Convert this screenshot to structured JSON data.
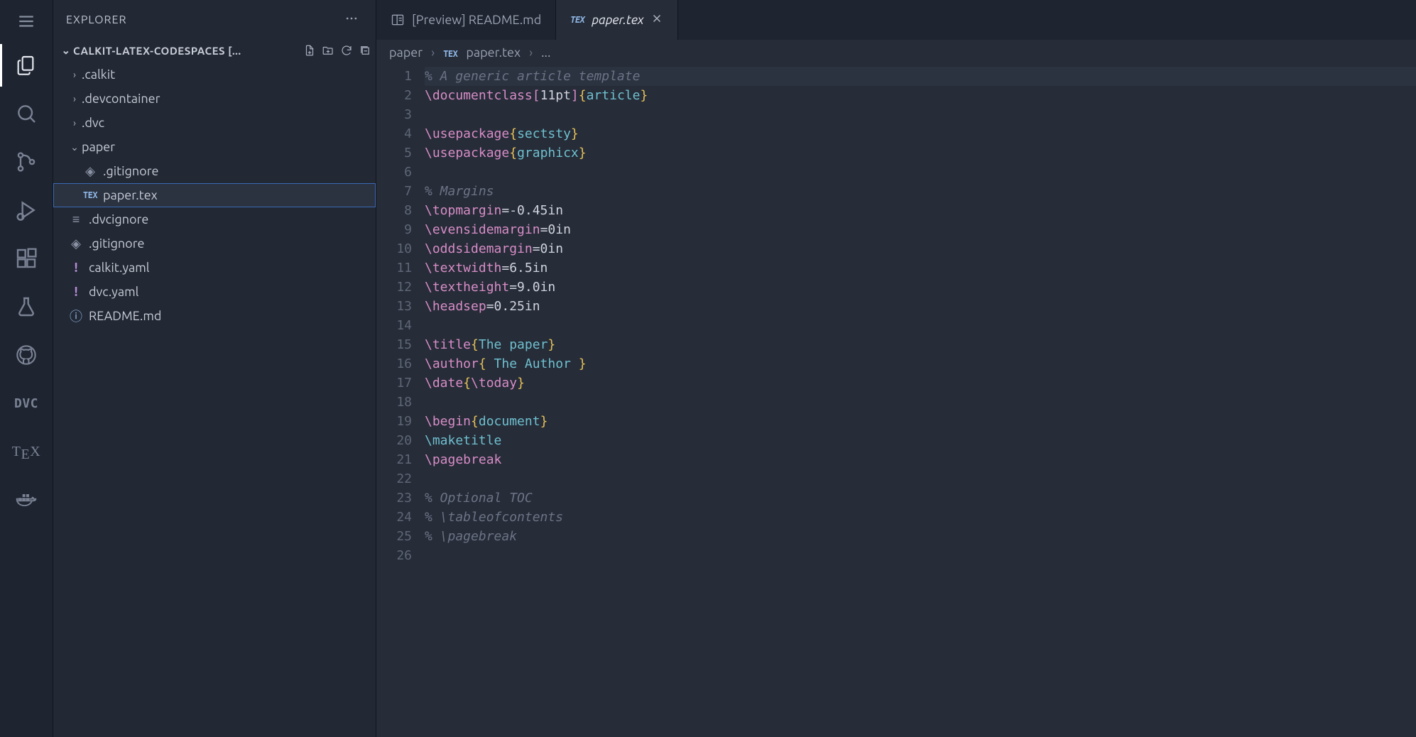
{
  "sidebar_title": "EXPLORER",
  "section_label": "CALKIT-LATEX-CODESPACES [...",
  "tree": {
    "calkit": ".calkit",
    "devcontainer": ".devcontainer",
    "dvc": ".dvc",
    "paper": "paper",
    "gitignore_inner": ".gitignore",
    "papertex": "paper.tex",
    "dvcignore": ".dvcignore",
    "gitignore_outer": ".gitignore",
    "calkit_yaml": "calkit.yaml",
    "dvc_yaml": "dvc.yaml",
    "readme": "README.md"
  },
  "tabs": {
    "preview_readme": "[Preview] README.md",
    "paper_tex": "paper.tex"
  },
  "breadcrumb": {
    "folder": "paper",
    "file": "paper.tex",
    "more": "..."
  },
  "activity": {
    "dvc": "DVC",
    "tex": "TEX"
  },
  "code_lines": [
    {
      "n": 1,
      "type": "comment",
      "text": "% A generic article template",
      "current": true
    },
    {
      "n": 2,
      "type": "docclass",
      "cmd": "\\documentclass",
      "opt": "11pt",
      "arg": "article"
    },
    {
      "n": 3,
      "type": "blank"
    },
    {
      "n": 4,
      "type": "usepkg",
      "cmd": "\\usepackage",
      "arg": "sectsty"
    },
    {
      "n": 5,
      "type": "usepkg",
      "cmd": "\\usepackage",
      "arg": "graphicx"
    },
    {
      "n": 6,
      "type": "blank"
    },
    {
      "n": 7,
      "type": "comment",
      "text": "% Margins"
    },
    {
      "n": 8,
      "type": "assign",
      "cmd": "\\topmargin",
      "val": "=-0.45in"
    },
    {
      "n": 9,
      "type": "assign",
      "cmd": "\\evensidemargin",
      "val": "=0in"
    },
    {
      "n": 10,
      "type": "assign",
      "cmd": "\\oddsidemargin",
      "val": "=0in"
    },
    {
      "n": 11,
      "type": "assign",
      "cmd": "\\textwidth",
      "val": "=6.5in"
    },
    {
      "n": 12,
      "type": "assign",
      "cmd": "\\textheight",
      "val": "=9.0in"
    },
    {
      "n": 13,
      "type": "assign",
      "cmd": "\\headsep",
      "val": "=0.25in"
    },
    {
      "n": 14,
      "type": "blank"
    },
    {
      "n": 15,
      "type": "cmdarg",
      "cmd": "\\title",
      "arg": "The paper"
    },
    {
      "n": 16,
      "type": "cmdarg",
      "cmd": "\\author",
      "arg": " The Author "
    },
    {
      "n": 17,
      "type": "cmdargcmd",
      "cmd": "\\date",
      "argcmd": "\\today"
    },
    {
      "n": 18,
      "type": "blank"
    },
    {
      "n": 19,
      "type": "cmdarg",
      "cmd": "\\begin",
      "arg": "document"
    },
    {
      "n": 20,
      "type": "cmdonly",
      "cmd": "\\maketitle"
    },
    {
      "n": 21,
      "type": "cmdonly_pink",
      "cmd": "\\pagebreak"
    },
    {
      "n": 22,
      "type": "blank"
    },
    {
      "n": 23,
      "type": "comment",
      "text": "% Optional TOC"
    },
    {
      "n": 24,
      "type": "comment",
      "text": "% \\tableofcontents"
    },
    {
      "n": 25,
      "type": "comment",
      "text": "% \\pagebreak"
    },
    {
      "n": 26,
      "type": "blank"
    }
  ]
}
